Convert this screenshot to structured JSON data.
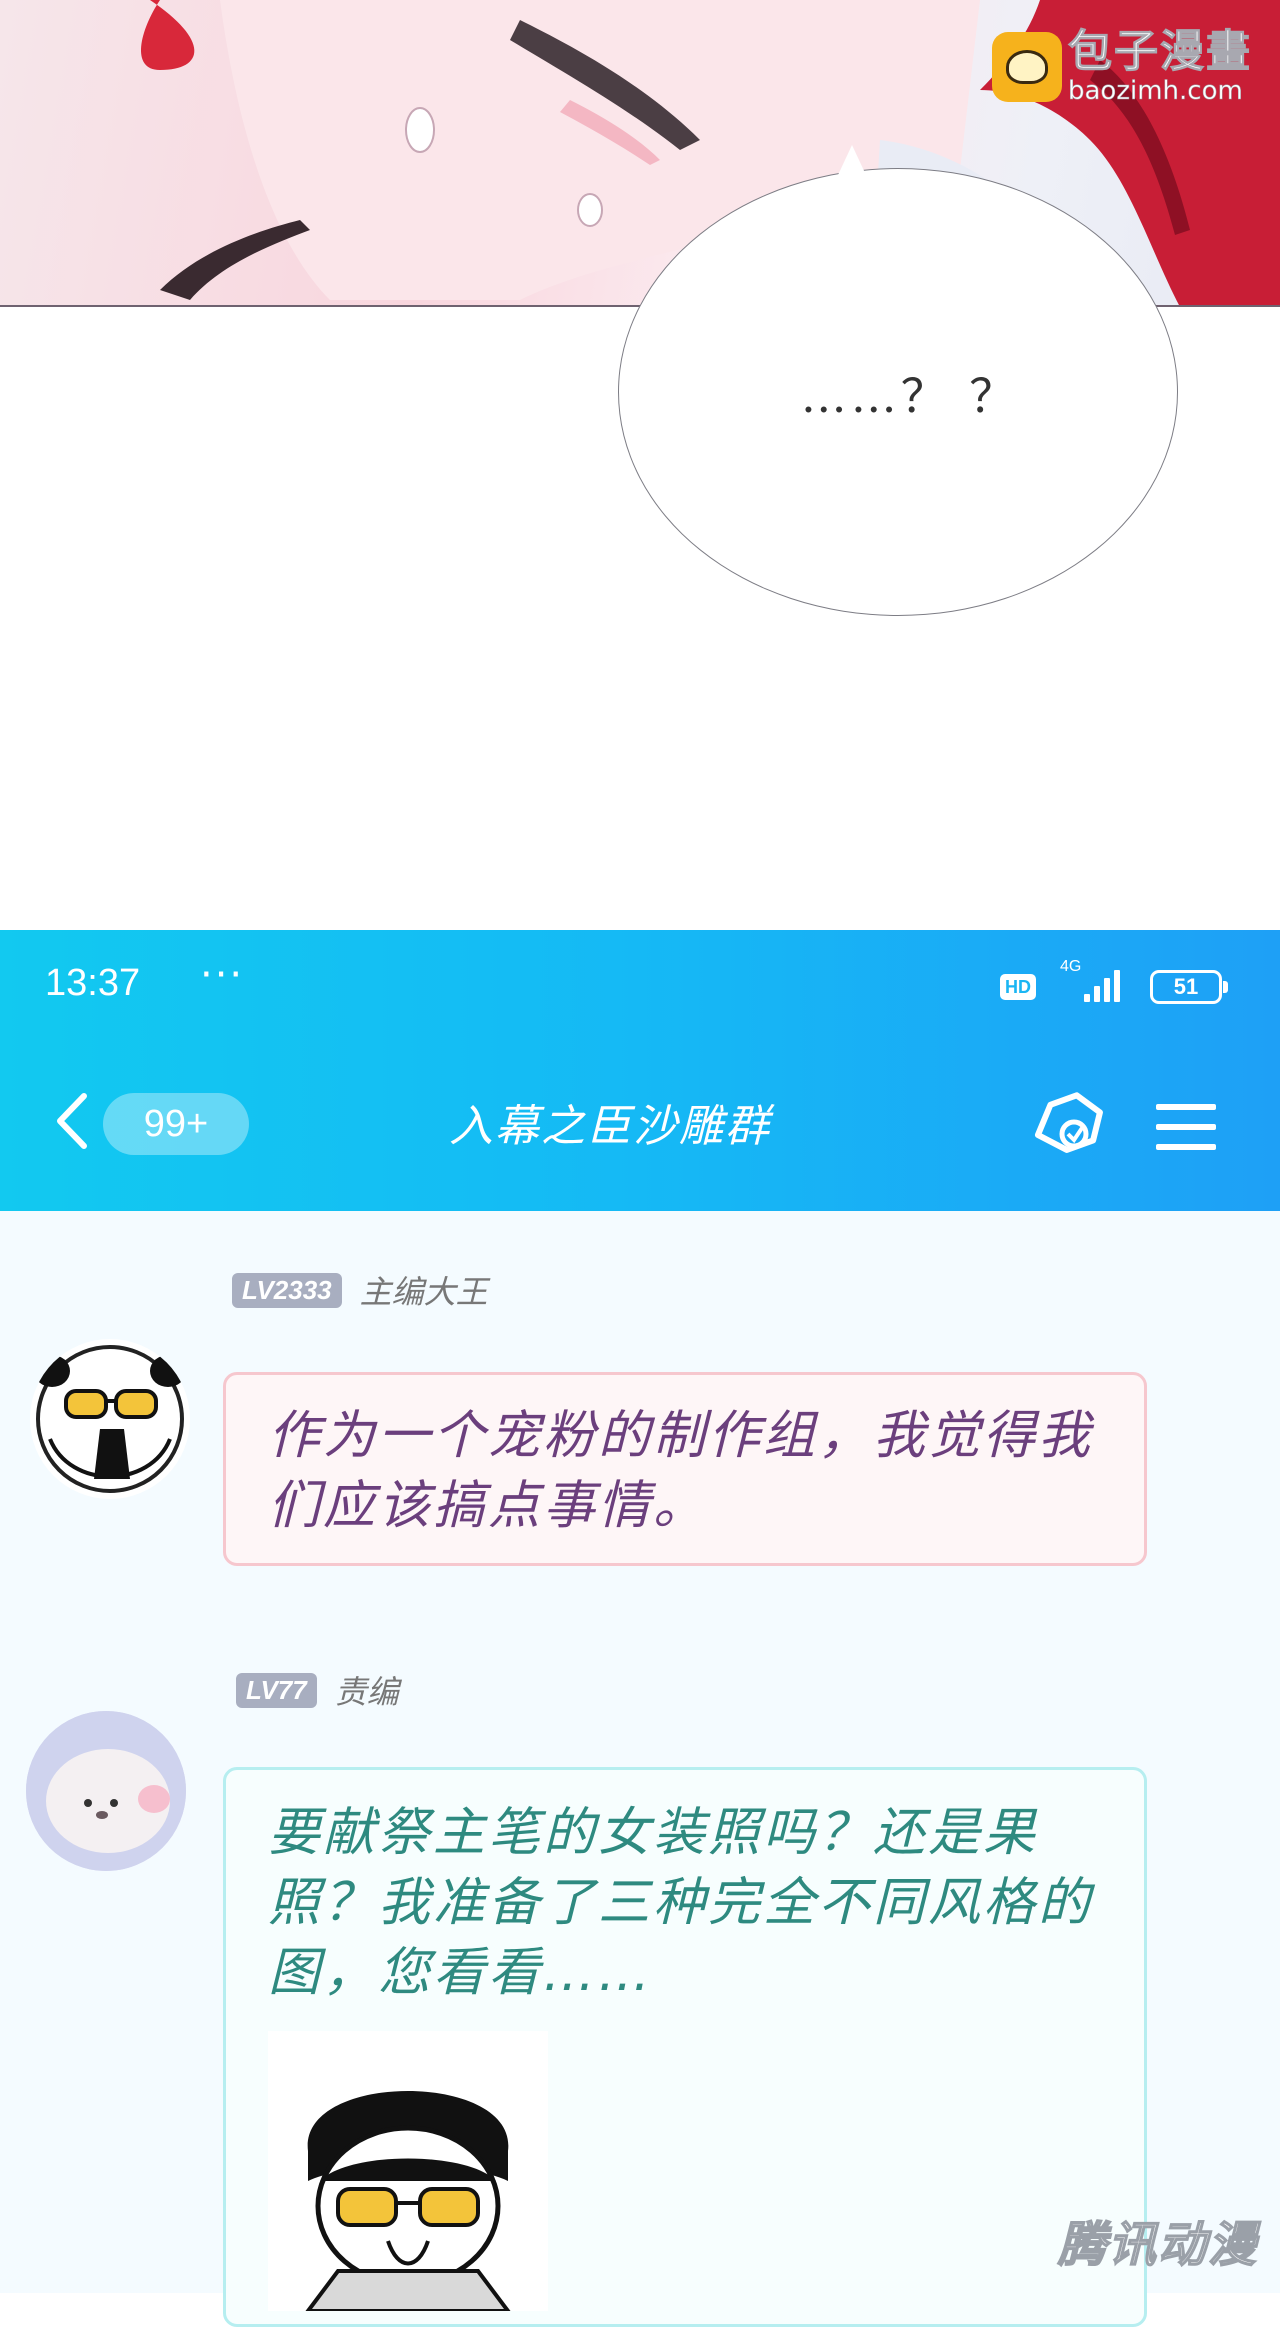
{
  "comic": {
    "watermark_title": "包子漫畫",
    "watermark_url": "baozimh.com",
    "speech_text": "……？ ？"
  },
  "status_bar": {
    "time": "13:37",
    "dots": "···",
    "hd": "HD",
    "network": "4G",
    "battery": "51"
  },
  "chat_header": {
    "unread_badge": "99+",
    "title": "入幕之臣沙雕群"
  },
  "messages": [
    {
      "level": "LV2333",
      "role": "主编大王",
      "text": "作为一个宠粉的制作组，我觉得我们应该搞点事情。"
    },
    {
      "level": "LV77",
      "role": "责编",
      "text": "要献祭主笔的女装照吗？还是果照？我准备了三种完全不同风格的图，您看看……"
    }
  ],
  "corner_watermark": "腾讯动漫",
  "colors": {
    "header_gradient_start": "#12c9f0",
    "header_gradient_end": "#1ea0f6",
    "bubble1_border": "#f6c7ce",
    "bubble1_text": "#6b3f7d",
    "bubble2_border": "#b6eef0",
    "bubble2_text": "#2e8a80"
  }
}
